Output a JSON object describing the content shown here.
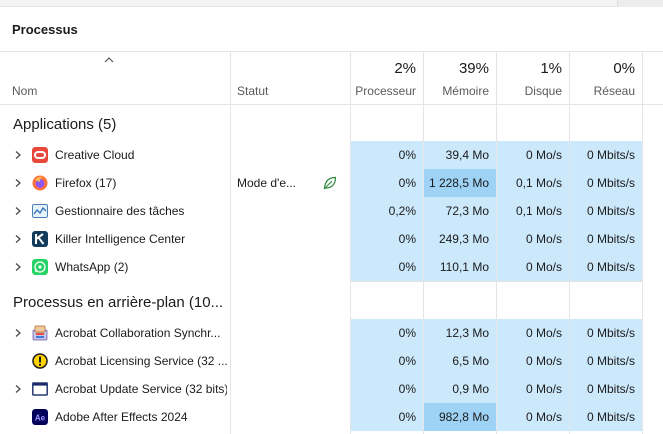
{
  "page": {
    "title": "Processus"
  },
  "columns": {
    "name": "Nom",
    "status": "Statut",
    "cpu": {
      "percent": "2%",
      "label": "Processeur"
    },
    "memory": {
      "percent": "39%",
      "label": "Mémoire"
    },
    "disk": {
      "percent": "1%",
      "label": "Disque"
    },
    "network": {
      "percent": "0%",
      "label": "Réseau"
    }
  },
  "groups": {
    "apps": {
      "title": "Applications (5)",
      "rows": [
        {
          "name": "Creative Cloud",
          "status": "",
          "cpu": "0%",
          "memory": "39,4 Mo",
          "disk": "0 Mo/s",
          "network": "0 Mbits/s",
          "icon": "creative-cloud-icon",
          "expandable": true
        },
        {
          "name": "Firefox (17)",
          "status": "Mode d'e...",
          "cpu": "0%",
          "memory": "1 228,5 Mo",
          "disk": "0,1 Mo/s",
          "network": "0 Mbits/s",
          "icon": "firefox-icon",
          "expandable": true,
          "efficiency": "leaf-icon"
        },
        {
          "name": "Gestionnaire des tâches",
          "status": "",
          "cpu": "0,2%",
          "memory": "72,3 Mo",
          "disk": "0,1 Mo/s",
          "network": "0 Mbits/s",
          "icon": "task-manager-icon",
          "expandable": true
        },
        {
          "name": "Killer Intelligence Center",
          "status": "",
          "cpu": "0%",
          "memory": "249,3 Mo",
          "disk": "0 Mo/s",
          "network": "0 Mbits/s",
          "icon": "killer-icon",
          "expandable": true
        },
        {
          "name": "WhatsApp (2)",
          "status": "",
          "cpu": "0%",
          "memory": "110,1 Mo",
          "disk": "0 Mo/s",
          "network": "0 Mbits/s",
          "icon": "whatsapp-icon",
          "expandable": true
        }
      ]
    },
    "background": {
      "title": "Processus en arrière-plan (10...",
      "rows": [
        {
          "name": "Acrobat Collaboration Synchr...",
          "status": "",
          "cpu": "0%",
          "memory": "12,3 Mo",
          "disk": "0 Mo/s",
          "network": "0 Mbits/s",
          "icon": "acrobat-sync-icon",
          "expandable": true
        },
        {
          "name": "Acrobat Licensing Service (32 ...",
          "status": "",
          "cpu": "0%",
          "memory": "6,5 Mo",
          "disk": "0 Mo/s",
          "network": "0 Mbits/s",
          "icon": "acrobat-licensing-icon",
          "expandable": false
        },
        {
          "name": "Acrobat Update Service (32 bits)",
          "status": "",
          "cpu": "0%",
          "memory": "0,9 Mo",
          "disk": "0 Mo/s",
          "network": "0 Mbits/s",
          "icon": "acrobat-update-icon",
          "expandable": true
        },
        {
          "name": "Adobe After Effects 2024",
          "status": "",
          "cpu": "0%",
          "memory": "982,8 Mo",
          "disk": "0 Mo/s",
          "network": "0 Mbits/s",
          "icon": "after-effects-icon",
          "expandable": false
        }
      ]
    }
  },
  "colors": {
    "heat_light": "#cce8fb",
    "heat_strong": "#9fd3f5",
    "grid": "#e5e5e5"
  }
}
